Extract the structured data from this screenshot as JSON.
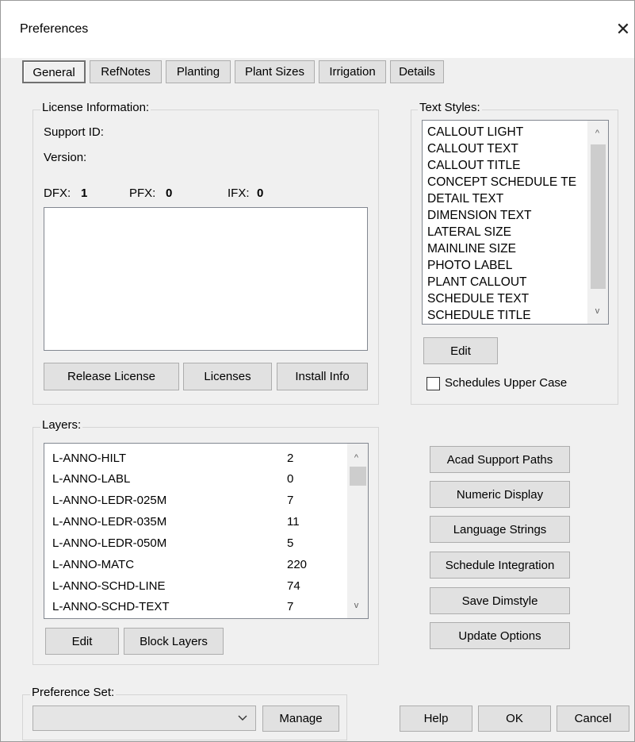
{
  "window": {
    "title": "Preferences",
    "close_glyph": "✕"
  },
  "tabs": [
    {
      "label": "General",
      "active": true
    },
    {
      "label": "RefNotes",
      "active": false
    },
    {
      "label": "Planting",
      "active": false
    },
    {
      "label": "Plant Sizes",
      "active": false
    },
    {
      "label": "Irrigation",
      "active": false
    },
    {
      "label": "Details",
      "active": false
    }
  ],
  "license": {
    "group_label": "License Information:",
    "support_id_label": "Support ID:",
    "version_label": "Version:",
    "dfx_label": "DFX:",
    "dfx_value": "1",
    "pfx_label": "PFX:",
    "pfx_value": "0",
    "ifx_label": "IFX:",
    "ifx_value": "0",
    "text_area_value": "",
    "buttons": {
      "release": "Release License",
      "licenses": "Licenses",
      "install_info": "Install Info"
    }
  },
  "text_styles": {
    "group_label": "Text Styles:",
    "items": [
      "CALLOUT LIGHT",
      "CALLOUT TEXT",
      "CALLOUT TITLE",
      "CONCEPT SCHEDULE TE",
      "DETAIL TEXT",
      "DIMENSION TEXT",
      "LATERAL SIZE",
      "MAINLINE SIZE",
      "PHOTO LABEL",
      "PLANT CALLOUT",
      "SCHEDULE TEXT",
      "SCHEDULE TITLE"
    ],
    "edit_label": "Edit",
    "upper_case_label": "Schedules Upper Case",
    "upper_case_checked": false
  },
  "layers": {
    "group_label": "Layers:",
    "rows": [
      {
        "name": "L-ANNO-HILT",
        "count": "2"
      },
      {
        "name": "L-ANNO-LABL",
        "count": "0"
      },
      {
        "name": "L-ANNO-LEDR-025M",
        "count": "7"
      },
      {
        "name": "L-ANNO-LEDR-035M",
        "count": "11"
      },
      {
        "name": "L-ANNO-LEDR-050M",
        "count": "5"
      },
      {
        "name": "L-ANNO-MATC",
        "count": "220"
      },
      {
        "name": "L-ANNO-SCHD-LINE",
        "count": "74"
      },
      {
        "name": "L-ANNO-SCHD-TEXT",
        "count": "7"
      }
    ],
    "edit_label": "Edit",
    "block_layers_label": "Block Layers"
  },
  "side_buttons": [
    "Acad Support Paths",
    "Numeric Display",
    "Language Strings",
    "Schedule Integration",
    "Save Dimstyle",
    "Update Options"
  ],
  "preference_set": {
    "group_label": "Preference Set:",
    "selected": "",
    "manage_label": "Manage"
  },
  "footer": {
    "help": "Help",
    "ok": "OK",
    "cancel": "Cancel"
  },
  "icons": {
    "scroll_up": "^",
    "scroll_down": "v",
    "dropdown": "chevron-down-icon"
  }
}
